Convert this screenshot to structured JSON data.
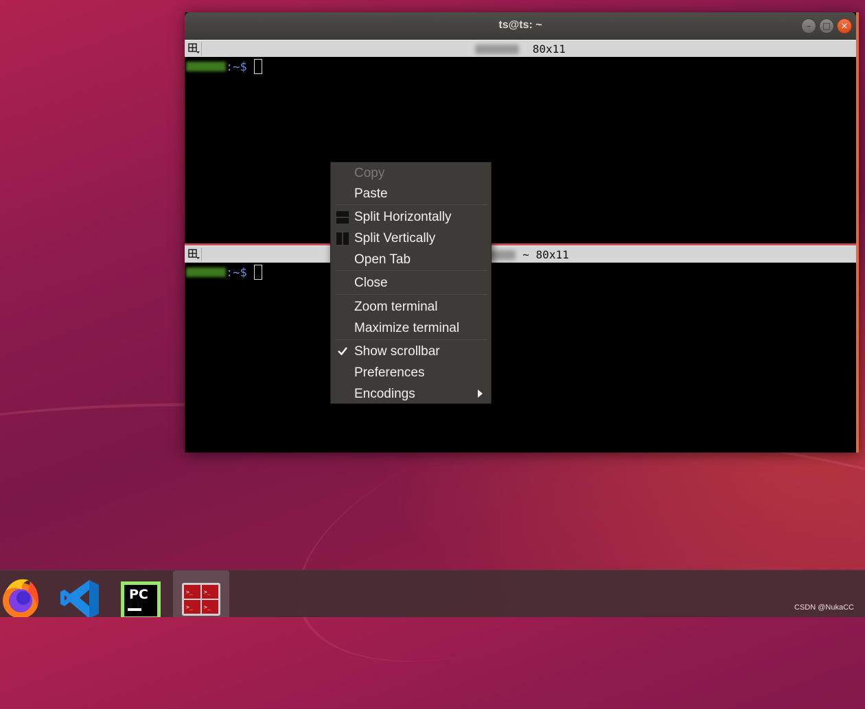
{
  "window": {
    "title": "ts@ts: ~",
    "buttons": {
      "minimize": "–",
      "maximize": "□",
      "close": "×"
    }
  },
  "panes": [
    {
      "title_suffix": " 80x11",
      "prompt_path": ":~$"
    },
    {
      "title_suffix": "~ 80x11",
      "prompt_path": ":~$"
    }
  ],
  "context_menu": {
    "items": [
      {
        "label": "Copy",
        "enabled": false
      },
      {
        "label": "Paste",
        "enabled": true
      },
      {
        "label": "Split Horizontally",
        "icon": "split-horizontal-icon"
      },
      {
        "label": "Split Vertically",
        "icon": "split-vertical-icon"
      },
      {
        "label": "Open Tab"
      },
      {
        "label": "Close"
      },
      {
        "label": "Zoom terminal"
      },
      {
        "label": "Maximize terminal"
      },
      {
        "label": "Show scrollbar",
        "checked": true
      },
      {
        "label": "Preferences"
      },
      {
        "label": "Encodings",
        "submenu": true
      }
    ]
  },
  "dock": {
    "apps": [
      "firefox-icon",
      "vscode-icon",
      "pycharm-icon",
      "terminator-icon"
    ],
    "pycharm_text": "PC"
  },
  "watermark": "CSDN @NukaCC",
  "colors": {
    "accent": "#e9673b",
    "desktop": "#8e1b4e",
    "menu_bg": "#3c3b37"
  }
}
